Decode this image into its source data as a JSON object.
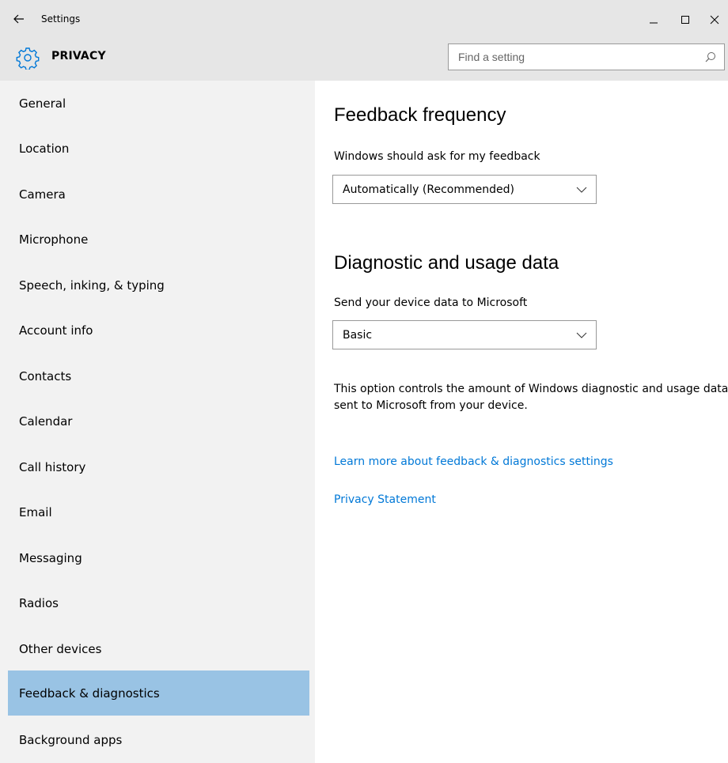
{
  "window": {
    "title": "Settings",
    "back_icon": "back-arrow-icon",
    "minimize_icon": "minimize-icon",
    "maximize_icon": "maximize-icon",
    "close_icon": "close-icon"
  },
  "header": {
    "icon": "gear-icon",
    "title": "PRIVACY",
    "accent_color": "#0078d7"
  },
  "search": {
    "placeholder": "Find a setting",
    "icon": "search-icon"
  },
  "sidebar": {
    "items": [
      {
        "label": "General",
        "selected": false
      },
      {
        "label": "Location",
        "selected": false
      },
      {
        "label": "Camera",
        "selected": false
      },
      {
        "label": "Microphone",
        "selected": false
      },
      {
        "label": "Speech, inking, & typing",
        "selected": false
      },
      {
        "label": "Account info",
        "selected": false
      },
      {
        "label": "Contacts",
        "selected": false
      },
      {
        "label": "Calendar",
        "selected": false
      },
      {
        "label": "Call history",
        "selected": false
      },
      {
        "label": "Email",
        "selected": false
      },
      {
        "label": "Messaging",
        "selected": false
      },
      {
        "label": "Radios",
        "selected": false
      },
      {
        "label": "Other devices",
        "selected": false
      },
      {
        "label": "Feedback & diagnostics",
        "selected": true
      },
      {
        "label": "Background apps",
        "selected": false
      }
    ],
    "selected_color": "#99c3e4"
  },
  "main": {
    "feedback": {
      "heading": "Feedback frequency",
      "label": "Windows should ask for my feedback",
      "value": "Automatically (Recommended)"
    },
    "diagnostics": {
      "heading": "Diagnostic and usage data",
      "label": "Send your device data to Microsoft",
      "value": "Basic",
      "description": "This option controls the amount of Windows diagnostic and usage data sent to Microsoft from your device."
    },
    "links": {
      "learn_more": "Learn more about feedback & diagnostics settings",
      "privacy_statement": "Privacy Statement"
    },
    "link_color": "#0078d7"
  }
}
